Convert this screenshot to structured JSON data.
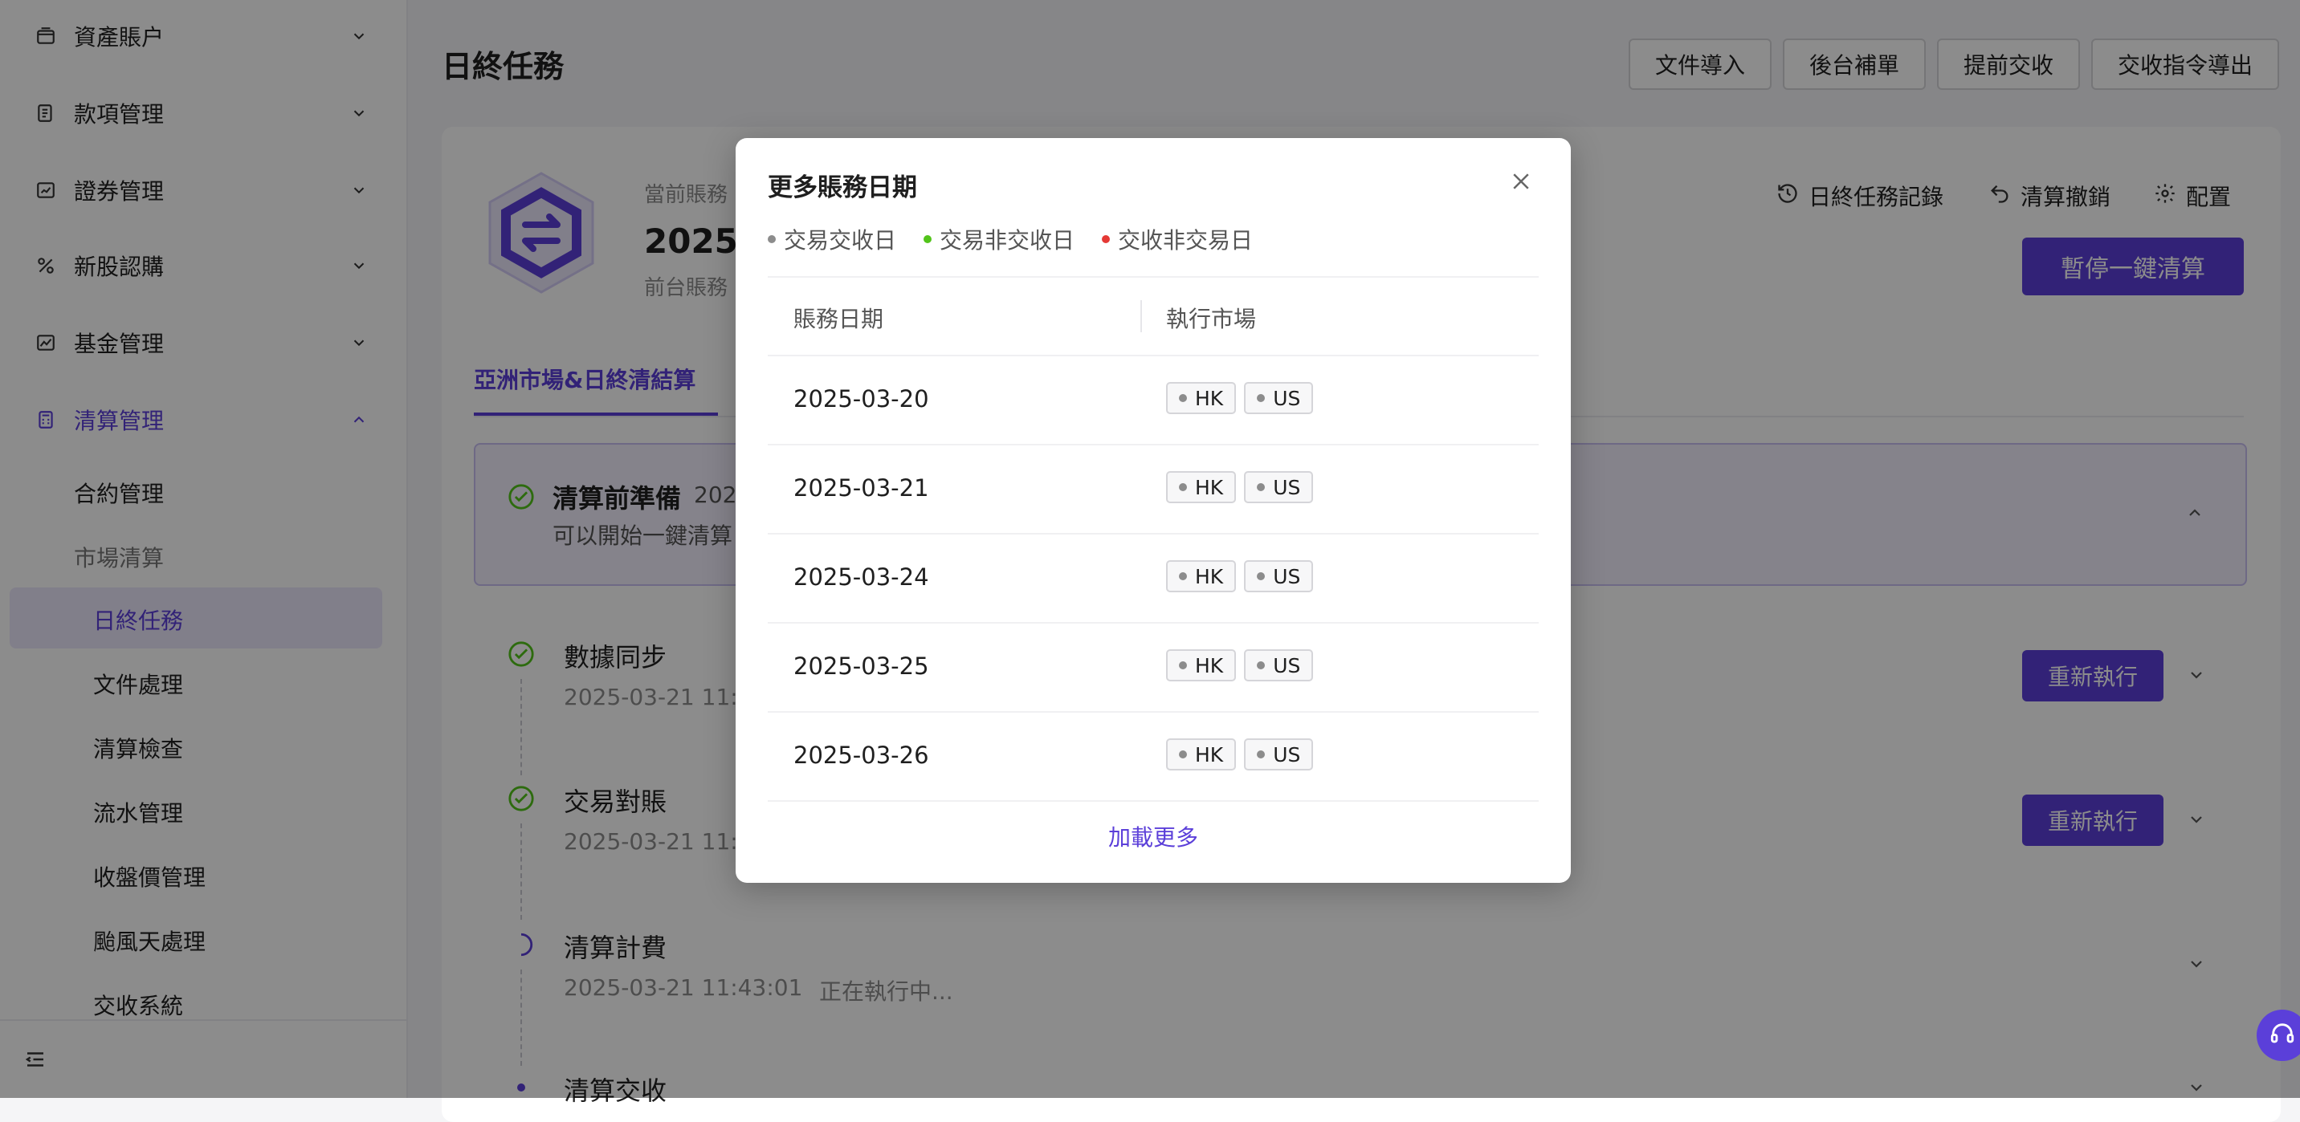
{
  "sidebar": {
    "groups": [
      {
        "label": "資產賬户"
      },
      {
        "label": "款項管理"
      },
      {
        "label": "證券管理"
      },
      {
        "label": "新股認購"
      },
      {
        "label": "基金管理"
      },
      {
        "label": "清算管理"
      }
    ],
    "sub_items": [
      {
        "label": "合約管理"
      },
      {
        "label": "市場清算"
      },
      {
        "label": "日終任務"
      },
      {
        "label": "文件處理"
      },
      {
        "label": "清算檢查"
      },
      {
        "label": "流水管理"
      },
      {
        "label": "收盤價管理"
      },
      {
        "label": "颱風天處理"
      },
      {
        "label": "交收系統"
      }
    ]
  },
  "header": {
    "title": "日終任務",
    "buttons": [
      "文件導入",
      "後台補單",
      "提前交收",
      "交收指令導出"
    ]
  },
  "summary": {
    "current_label": "當前賬務",
    "current_date": "2025-",
    "front_label": "前台賬務",
    "actions": [
      "日終任務記錄",
      "清算撤銷",
      "配置"
    ],
    "pause_button": "暫停一鍵清算"
  },
  "tabs": {
    "active": "亞洲市場&日終清結算"
  },
  "steps": {
    "prep": {
      "title": "清算前準備",
      "date": "202",
      "desc": "可以開始一鍵清算"
    },
    "sync": {
      "title": "數據同步",
      "time": "2025-03-21 11:",
      "button": "重新執行"
    },
    "recon": {
      "title": "交易對賬",
      "time": "2025-03-21 11:",
      "button": "重新執行"
    },
    "fee": {
      "title": "清算計費",
      "time": "2025-03-21 11:43:01",
      "status": "正在執行中..."
    },
    "settle": {
      "title": "清算交收"
    }
  },
  "modal": {
    "title": "更多賬務日期",
    "legend": [
      {
        "label": "交易交收日",
        "color": "#8c8c8c"
      },
      {
        "label": "交易非交收日",
        "color": "#52c41a"
      },
      {
        "label": "交收非交易日",
        "color": "#e53935"
      }
    ],
    "columns": [
      "賬務日期",
      "執行市場"
    ],
    "rows": [
      {
        "date": "2025-03-20",
        "markets": [
          "HK",
          "US"
        ]
      },
      {
        "date": "2025-03-21",
        "markets": [
          "HK",
          "US"
        ]
      },
      {
        "date": "2025-03-24",
        "markets": [
          "HK",
          "US"
        ]
      },
      {
        "date": "2025-03-25",
        "markets": [
          "HK",
          "US"
        ]
      },
      {
        "date": "2025-03-26",
        "markets": [
          "HK",
          "US"
        ]
      }
    ],
    "load_more": "加載更多"
  },
  "colors": {
    "accent": "#5b3fd9",
    "success": "#52c41a",
    "danger": "#e53935"
  }
}
